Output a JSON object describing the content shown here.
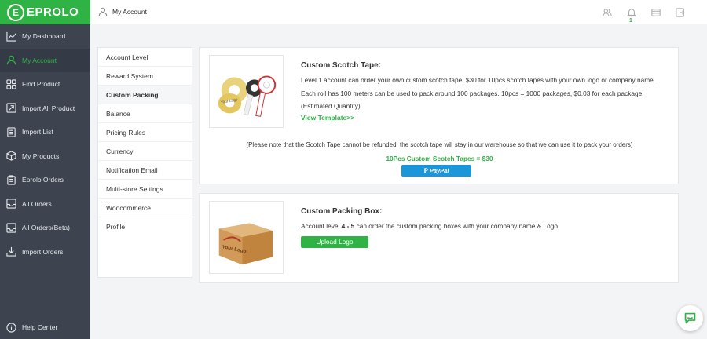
{
  "brand": {
    "logo_letter": "E",
    "name": "EPROLO",
    "accent": "#2fb344"
  },
  "topbar": {
    "title": "My Account",
    "notification_count": "1"
  },
  "sidebar": {
    "items": [
      {
        "label": "My Dashboard",
        "icon": "chart-icon"
      },
      {
        "label": "My Account",
        "icon": "user-icon"
      },
      {
        "label": "Find Product",
        "icon": "grid-icon"
      },
      {
        "label": "Import All Product",
        "icon": "import-icon"
      },
      {
        "label": "Import List",
        "icon": "list-icon"
      },
      {
        "label": "My Products",
        "icon": "box-icon"
      },
      {
        "label": "Eprolo Orders",
        "icon": "clipboard-icon"
      },
      {
        "label": "All Orders",
        "icon": "inbox-icon"
      },
      {
        "label": "All Orders(Beta)",
        "icon": "inbox-icon"
      },
      {
        "label": "Import Orders",
        "icon": "download-icon"
      }
    ],
    "help": "Help Center"
  },
  "menu": {
    "items": [
      "Account Level",
      "Reward System",
      "Custom Packing",
      "Balance",
      "Pricing Rules",
      "Currency",
      "Notification Email",
      "Multi-store Settings",
      "Woocommerce",
      "Profile"
    ]
  },
  "tape": {
    "title": "Custom Scotch Tape:",
    "text": "Level 1 account can order your own custom scotch tape, $30 for 10pcs scotch tapes with your own logo or company name. Each roll has 100 meters can be used to pack around 100 packages. 10pcs = 1000 packages, $0.03 for each package.(Estimated Quantity)",
    "link": "View Template>>",
    "note": "(Please note that the Scotch Tape cannot be refunded, the scotch tape will stay in our warehouse so that we can use it to pack your orders)",
    "price": "10Pcs Custom Scotch Tapes = $30",
    "paypal": "PayPal",
    "image_text": "Your Logo"
  },
  "box": {
    "title": "Custom Packing Box:",
    "text_pre": "Account level ",
    "text_level": "4 - 5",
    "text_post": " can order the custom packing boxes with your company name & Logo.",
    "button": "Upload Logo",
    "image_text": "Your Logo"
  }
}
